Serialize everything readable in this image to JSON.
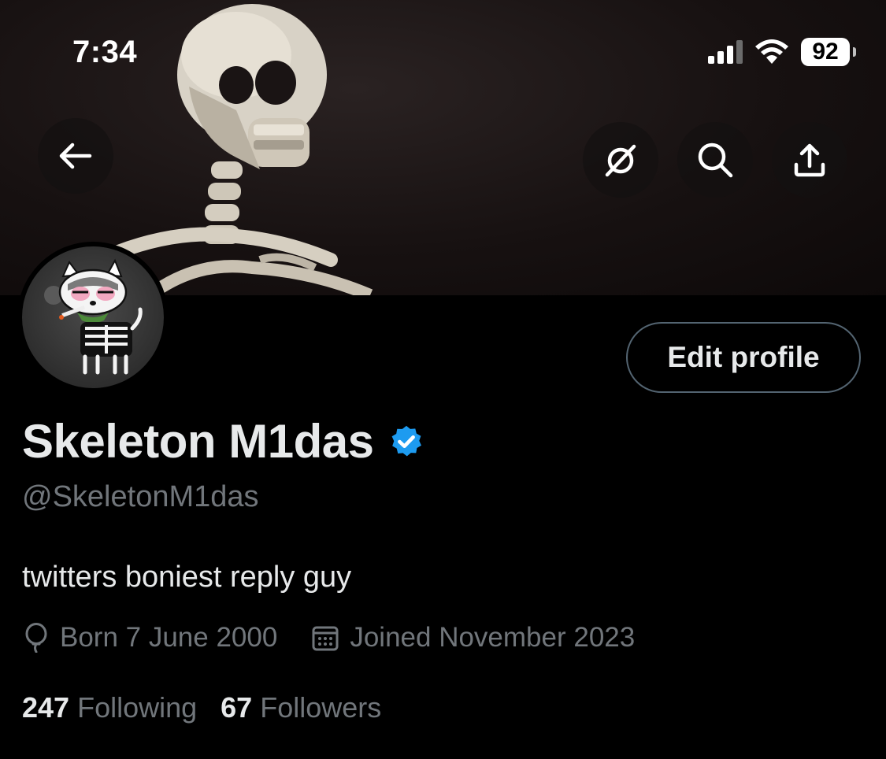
{
  "status_bar": {
    "time": "7:34",
    "battery": "92",
    "icons": [
      "signal-icon",
      "wifi-icon",
      "battery-icon"
    ]
  },
  "banner": {
    "description_icon": "skeleton-banner",
    "buttons": [
      "back-arrow-icon",
      "grok-icon",
      "search-icon",
      "share-icon"
    ]
  },
  "profile": {
    "display_name": "Skeleton M1das",
    "verified": true,
    "handle": "@SkeletonM1das",
    "bio": "twitters boniest reply guy",
    "born": "Born 7 June 2000",
    "joined": "Joined November 2023",
    "following_count": "247",
    "following_label": "Following",
    "followers_count": "67",
    "followers_label": "Followers",
    "edit_button": "Edit profile"
  },
  "colors": {
    "background": "#000000",
    "text_primary": "#e7e9ea",
    "text_secondary": "#71767b",
    "verified_blue": "#1d9bf0",
    "button_border": "#536471"
  }
}
